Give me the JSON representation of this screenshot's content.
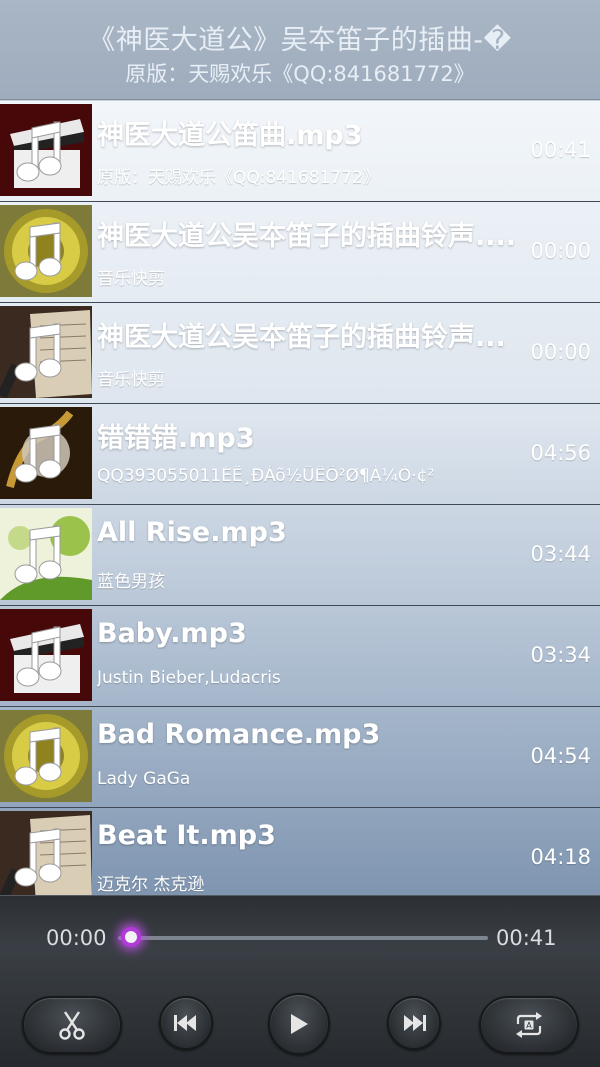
{
  "header": {
    "title": "《神医大道公》吴夲笛子的插曲-�",
    "subtitle": "原版：天赐欢乐《QQ:841681772》"
  },
  "songs": [
    {
      "title": "神医大道公笛曲.mp3",
      "artist": "原版：天赐欢乐《QQ:841681772》",
      "duration": "00:41",
      "art": "film-music"
    },
    {
      "title": "神医大道公吴夲笛子的插曲铃声....",
      "artist": "音乐快剪",
      "duration": "00:00",
      "art": "gold-disc"
    },
    {
      "title": "神医大道公吴夲笛子的插曲铃声...",
      "artist": "音乐快剪",
      "duration": "00:00",
      "art": "sheet-microphone"
    },
    {
      "title": "错错错.mp3",
      "artist": "QQ393055011ÉË¸ÐÁõ½ÜÊÕ²Ø¶À¼Ò·¢²",
      "duration": "04:56",
      "art": "saxophone"
    },
    {
      "title": "All Rise.mp3",
      "artist": "蓝色男孩",
      "duration": "03:44",
      "art": "green-tree"
    },
    {
      "title": "Baby.mp3",
      "artist": "Justin Bieber,Ludacris",
      "duration": "03:34",
      "art": "film-music"
    },
    {
      "title": "Bad Romance.mp3",
      "artist": "Lady GaGa",
      "duration": "04:54",
      "art": "gold-disc"
    },
    {
      "title": "Beat It.mp3",
      "artist": "迈克尔 杰克逊",
      "duration": "04:18",
      "art": "sheet-microphone"
    }
  ],
  "player": {
    "current_time": "00:00",
    "total_time": "00:41",
    "progress_fraction": 0.0,
    "buttons": [
      "scissors-icon",
      "previous-icon",
      "play-icon",
      "next-icon",
      "repeat-icon"
    ],
    "accent_color": "#b13ad8"
  }
}
